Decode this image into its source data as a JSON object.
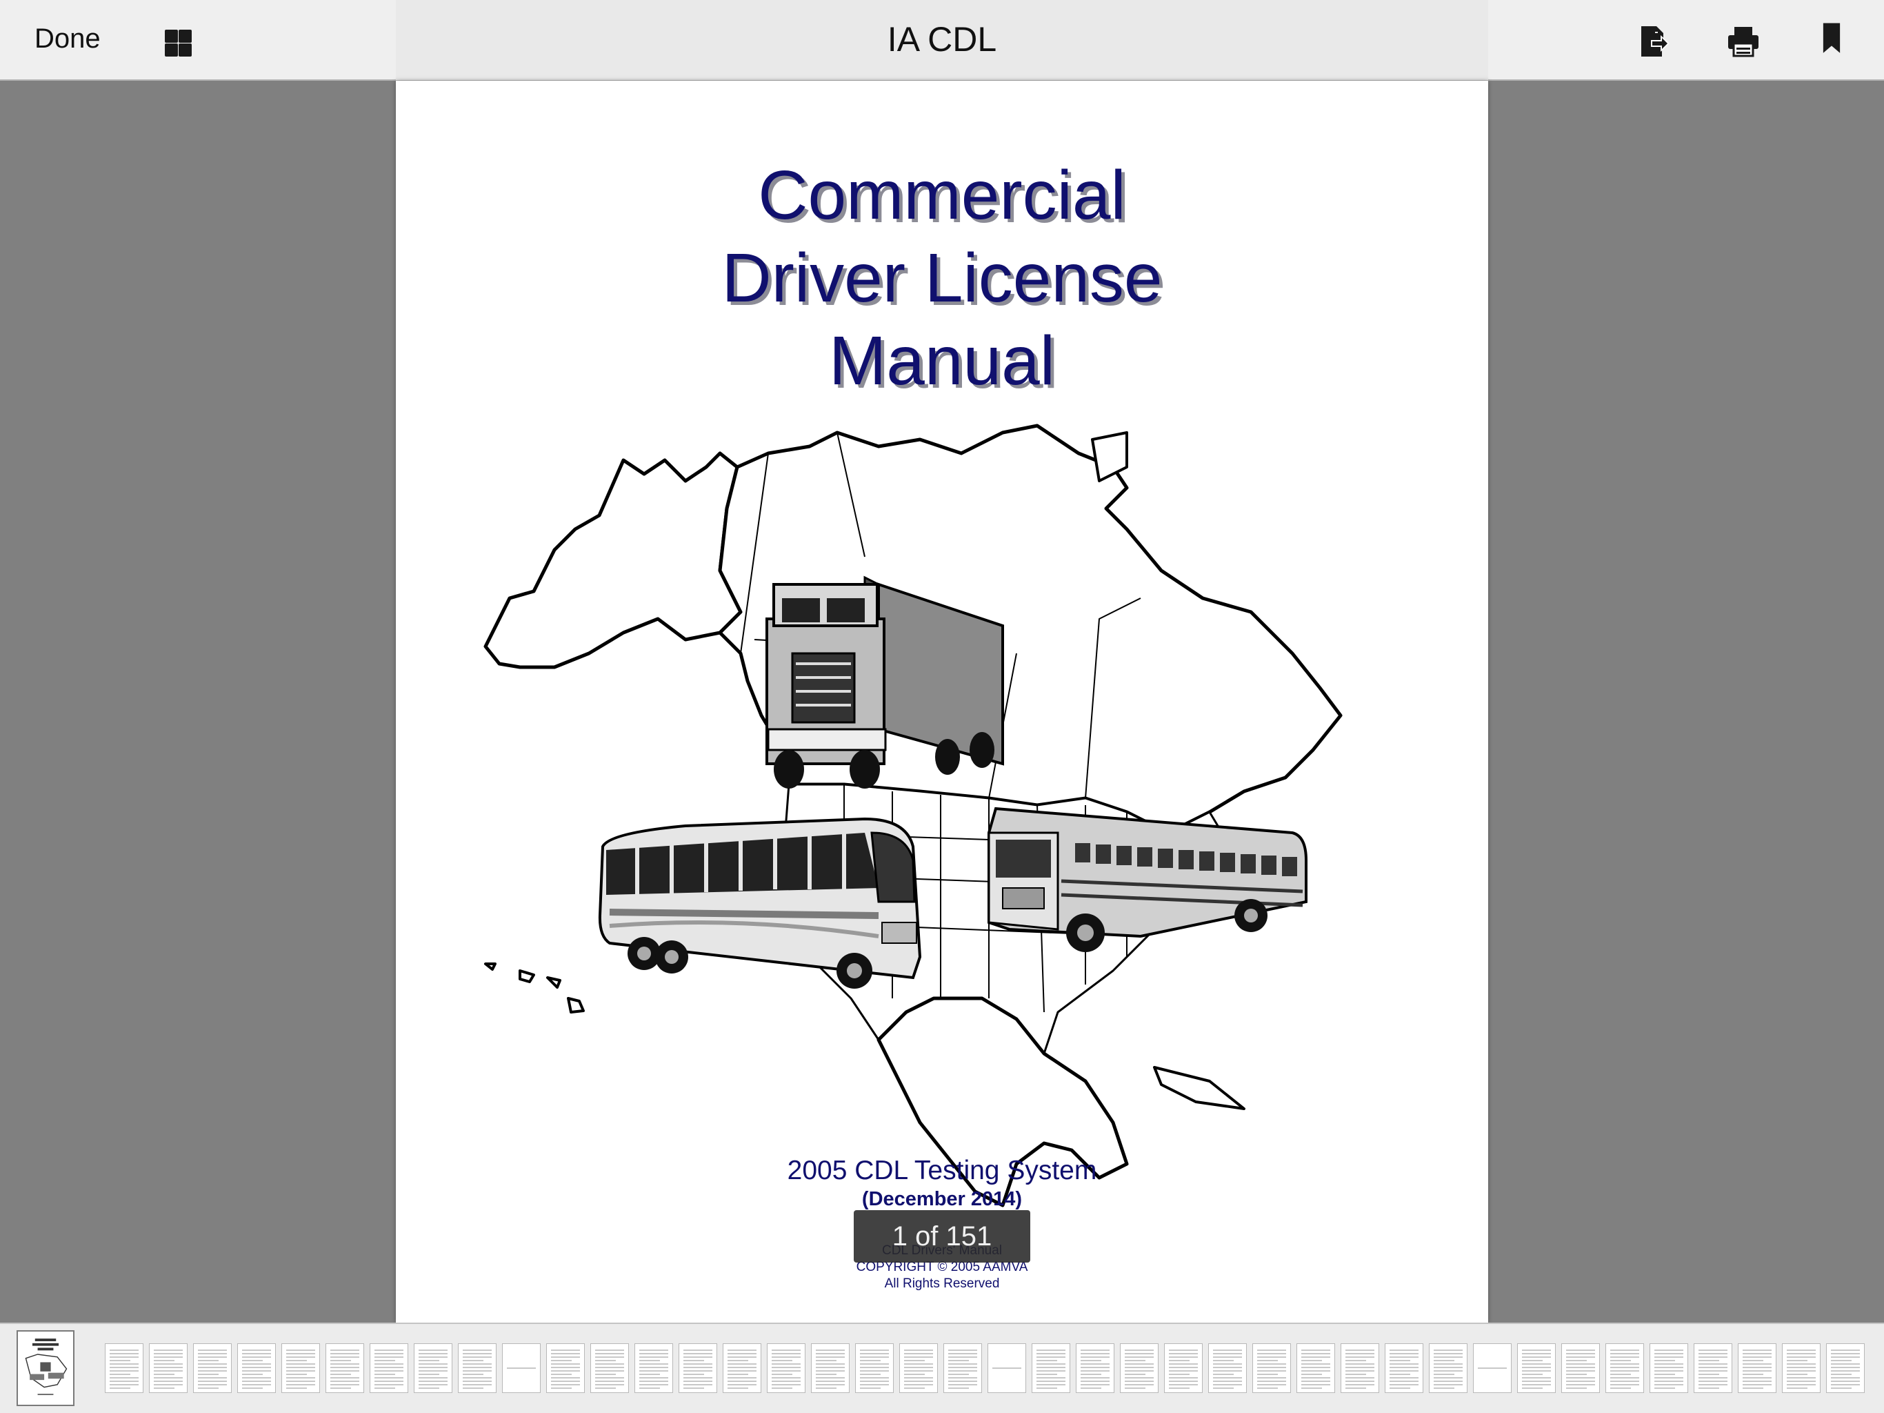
{
  "toolbar": {
    "done_label": "Done",
    "title": "IA CDL",
    "icons": [
      "grid-icon",
      "share-export-icon",
      "print-icon",
      "bookmark-icon"
    ]
  },
  "document": {
    "title_lines": [
      "Commercial",
      "Driver License",
      "Manual"
    ],
    "subtitle": "2005 CDL Testing System",
    "edition": "(December 2014)",
    "footer_line1": "CDL  Drivers' Manual",
    "footer_line2": "COPYRIGHT © 2005 AAMVA",
    "footer_line3": "All Rights Reserved"
  },
  "page_indicator": "1 of 151",
  "colors": {
    "title_navy": "#10106e",
    "background_gray": "#808080",
    "toolbar_bg": "#efefef"
  }
}
